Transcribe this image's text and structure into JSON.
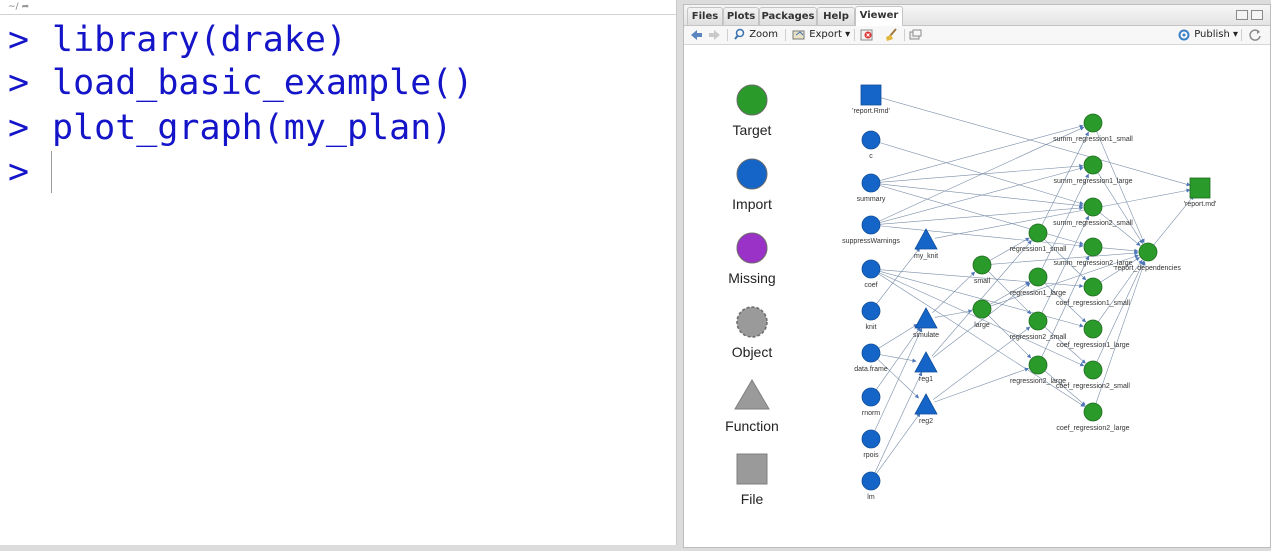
{
  "console": {
    "path": "~/",
    "prompt": ">",
    "lines": [
      "library(drake)",
      "load_basic_example()",
      "plot_graph(my_plan)",
      ""
    ]
  },
  "viewer": {
    "tabs": [
      "Files",
      "Plots",
      "Packages",
      "Help",
      "Viewer"
    ],
    "active_tab": "Viewer",
    "toolbar": {
      "zoom": "Zoom",
      "export": "Export",
      "publish": "Publish"
    }
  },
  "legend": [
    {
      "label": "Target",
      "shape": "circle",
      "color": "#2a9a2a"
    },
    {
      "label": "Import",
      "shape": "circle",
      "color": "#1565c8"
    },
    {
      "label": "Missing",
      "shape": "circle",
      "color": "#9a32c8"
    },
    {
      "label": "Object",
      "shape": "circle-dashed",
      "color": "#9a9a9a"
    },
    {
      "label": "Function",
      "shape": "triangle",
      "color": "#9a9a9a"
    },
    {
      "label": "File",
      "shape": "square",
      "color": "#9a9a9a"
    }
  ],
  "colors": {
    "target": "#2a9a2a",
    "import": "#1565c8",
    "edge": "#7a8ea8"
  },
  "graph": {
    "nodes": [
      {
        "id": "report_rmd",
        "label": "'report.Rmd'",
        "type": "import",
        "shape": "square"
      },
      {
        "id": "c",
        "label": "c",
        "type": "import",
        "shape": "circle"
      },
      {
        "id": "summary",
        "label": "summary",
        "type": "import",
        "shape": "circle"
      },
      {
        "id": "suppressWarnings",
        "label": "suppressWarnings",
        "type": "import",
        "shape": "circle"
      },
      {
        "id": "coef",
        "label": "coef",
        "type": "import",
        "shape": "circle"
      },
      {
        "id": "knit",
        "label": "knit",
        "type": "import",
        "shape": "circle"
      },
      {
        "id": "data_frame",
        "label": "data.frame",
        "type": "import",
        "shape": "circle"
      },
      {
        "id": "rnorm",
        "label": "rnorm",
        "type": "import",
        "shape": "circle"
      },
      {
        "id": "rpois",
        "label": "rpois",
        "type": "import",
        "shape": "circle"
      },
      {
        "id": "lm",
        "label": "lm",
        "type": "import",
        "shape": "circle"
      },
      {
        "id": "my_knit",
        "label": "my_knit",
        "type": "import",
        "shape": "triangle"
      },
      {
        "id": "simulate",
        "label": "simulate",
        "type": "import",
        "shape": "triangle"
      },
      {
        "id": "reg1",
        "label": "reg1",
        "type": "import",
        "shape": "triangle"
      },
      {
        "id": "reg2",
        "label": "reg2",
        "type": "import",
        "shape": "triangle"
      },
      {
        "id": "small",
        "label": "small",
        "type": "target",
        "shape": "circle"
      },
      {
        "id": "large",
        "label": "large",
        "type": "target",
        "shape": "circle"
      },
      {
        "id": "regression1_small",
        "label": "regression1_small",
        "type": "target",
        "shape": "circle"
      },
      {
        "id": "regression1_large",
        "label": "regression1_large",
        "type": "target",
        "shape": "circle"
      },
      {
        "id": "regression2_small",
        "label": "regression2_small",
        "type": "target",
        "shape": "circle"
      },
      {
        "id": "regression2_large",
        "label": "regression2_large",
        "type": "target",
        "shape": "circle"
      },
      {
        "id": "summ_regression1_small",
        "label": "summ_regression1_small",
        "type": "target",
        "shape": "circle"
      },
      {
        "id": "summ_regression1_large",
        "label": "summ_regression1_large",
        "type": "target",
        "shape": "circle"
      },
      {
        "id": "summ_regression2_small",
        "label": "summ_regression2_small",
        "type": "target",
        "shape": "circle"
      },
      {
        "id": "summ_regression2_large",
        "label": "summ_regression2_large",
        "type": "target",
        "shape": "circle"
      },
      {
        "id": "coef_regression1_small",
        "label": "coef_regression1_small",
        "type": "target",
        "shape": "circle"
      },
      {
        "id": "coef_regression1_large",
        "label": "coef_regression1_large",
        "type": "target",
        "shape": "circle"
      },
      {
        "id": "coef_regression2_small",
        "label": "coef_regression2_small",
        "type": "target",
        "shape": "circle"
      },
      {
        "id": "coef_regression2_large",
        "label": "coef_regression2_large",
        "type": "target",
        "shape": "circle"
      },
      {
        "id": "report_dependencies",
        "label": "report_dependencies",
        "type": "target",
        "shape": "circle"
      },
      {
        "id": "report_md",
        "label": "'report.md'",
        "type": "target",
        "shape": "square"
      }
    ],
    "edges": [
      [
        "report_rmd",
        "report_md"
      ],
      [
        "c",
        "summ_regression2_small"
      ],
      [
        "summary",
        "summ_regression1_small"
      ],
      [
        "summary",
        "summ_regression1_large"
      ],
      [
        "summary",
        "summ_regression2_small"
      ],
      [
        "summary",
        "summ_regression2_large"
      ],
      [
        "suppressWarnings",
        "summ_regression1_small"
      ],
      [
        "suppressWarnings",
        "summ_regression1_large"
      ],
      [
        "suppressWarnings",
        "summ_regression2_small"
      ],
      [
        "suppressWarnings",
        "summ_regression2_large"
      ],
      [
        "coef",
        "coef_regression1_small"
      ],
      [
        "coef",
        "coef_regression1_large"
      ],
      [
        "coef",
        "coef_regression2_small"
      ],
      [
        "coef",
        "coef_regression2_large"
      ],
      [
        "knit",
        "my_knit"
      ],
      [
        "data_frame",
        "simulate"
      ],
      [
        "data_frame",
        "reg1"
      ],
      [
        "data_frame",
        "reg2"
      ],
      [
        "rnorm",
        "simulate"
      ],
      [
        "rpois",
        "simulate"
      ],
      [
        "lm",
        "reg1"
      ],
      [
        "lm",
        "reg2"
      ],
      [
        "my_knit",
        "report_md"
      ],
      [
        "simulate",
        "small"
      ],
      [
        "simulate",
        "large"
      ],
      [
        "reg1",
        "regression1_small"
      ],
      [
        "reg1",
        "regression1_large"
      ],
      [
        "reg2",
        "regression2_small"
      ],
      [
        "reg2",
        "regression2_large"
      ],
      [
        "small",
        "regression1_small"
      ],
      [
        "small",
        "regression2_small"
      ],
      [
        "large",
        "regression1_large"
      ],
      [
        "large",
        "regression2_large"
      ],
      [
        "small",
        "report_dependencies"
      ],
      [
        "large",
        "report_dependencies"
      ],
      [
        "regression1_small",
        "summ_regression1_small"
      ],
      [
        "regression1_small",
        "coef_regression1_small"
      ],
      [
        "regression1_large",
        "summ_regression1_large"
      ],
      [
        "regression1_large",
        "coef_regression1_large"
      ],
      [
        "regression2_small",
        "summ_regression2_small"
      ],
      [
        "regression2_small",
        "coef_regression2_small"
      ],
      [
        "regression2_large",
        "summ_regression2_large"
      ],
      [
        "regression2_large",
        "coef_regression2_large"
      ],
      [
        "summ_regression1_small",
        "report_dependencies"
      ],
      [
        "summ_regression1_large",
        "report_dependencies"
      ],
      [
        "summ_regression2_small",
        "report_dependencies"
      ],
      [
        "summ_regression2_large",
        "report_dependencies"
      ],
      [
        "coef_regression1_small",
        "report_dependencies"
      ],
      [
        "coef_regression1_large",
        "report_dependencies"
      ],
      [
        "coef_regression2_small",
        "report_dependencies"
      ],
      [
        "coef_regression2_large",
        "report_dependencies"
      ],
      [
        "report_dependencies",
        "report_md"
      ]
    ]
  }
}
